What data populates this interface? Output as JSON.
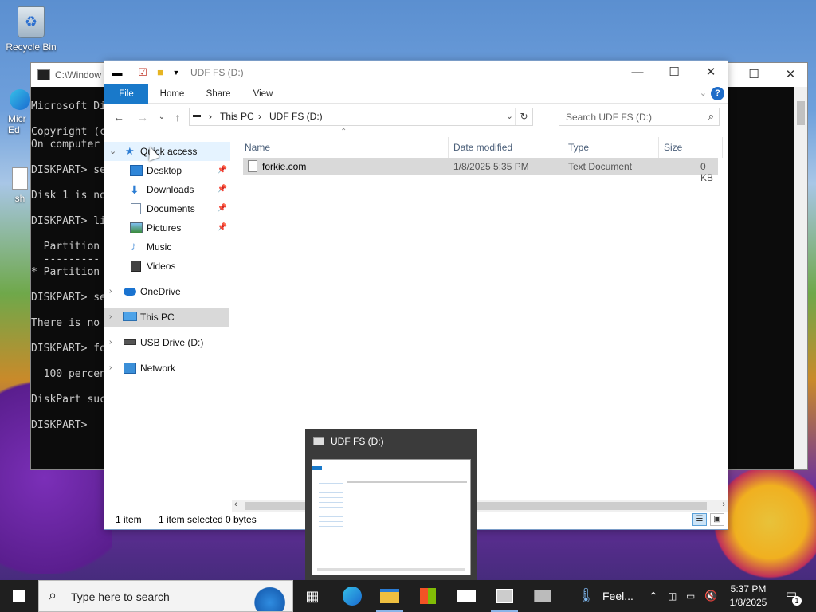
{
  "desktop": {
    "recycle_bin": "Recycle Bin",
    "edge_label_1": "Micr",
    "edge_label_2": "Ed",
    "sh_label": "sh"
  },
  "console": {
    "title": "C:\\Window",
    "lines": [
      "Microsoft Di",
      "Copyright (c",
      "On computer",
      "DISKPART> se",
      "Disk 1 is no",
      "DISKPART> li",
      "  Partition",
      "  ---------",
      "* Partition",
      "DISKPART> se",
      "There is no",
      "DISKPART> fo",
      "  100 percen",
      "DiskPart suc",
      "DISKPART>"
    ]
  },
  "explorer": {
    "title": "UDF FS (D:)",
    "ribbon_tabs": [
      "File",
      "Home",
      "Share",
      "View"
    ],
    "help_label": "?",
    "address": {
      "segments": [
        "This PC",
        "UDF FS (D:)"
      ]
    },
    "search_placeholder": "Search UDF FS (D:)",
    "nav": {
      "quick_access": "Quick access",
      "desktop": "Desktop",
      "downloads": "Downloads",
      "documents": "Documents",
      "pictures": "Pictures",
      "music": "Music",
      "videos": "Videos",
      "onedrive": "OneDrive",
      "this_pc": "This PC",
      "usb": "USB Drive (D:)",
      "network": "Network"
    },
    "columns": {
      "name": "Name",
      "date": "Date modified",
      "type": "Type",
      "size": "Size"
    },
    "files": [
      {
        "name": "forkie.com",
        "date": "1/8/2025 5:35 PM",
        "type": "Text Document",
        "size": "0 KB"
      }
    ],
    "status": {
      "count": "1 item",
      "selected": "1 item selected",
      "bytes": "0 bytes"
    }
  },
  "thumbnail": {
    "title": "UDF FS (D:)"
  },
  "taskbar": {
    "search_placeholder": "Type here to search",
    "weather": "Feel...",
    "time": "5:37 PM",
    "date": "1/8/2025",
    "notifications": "1"
  },
  "colors": {
    "accent": "#1979ca",
    "taskbar": "#1f1f1f"
  }
}
